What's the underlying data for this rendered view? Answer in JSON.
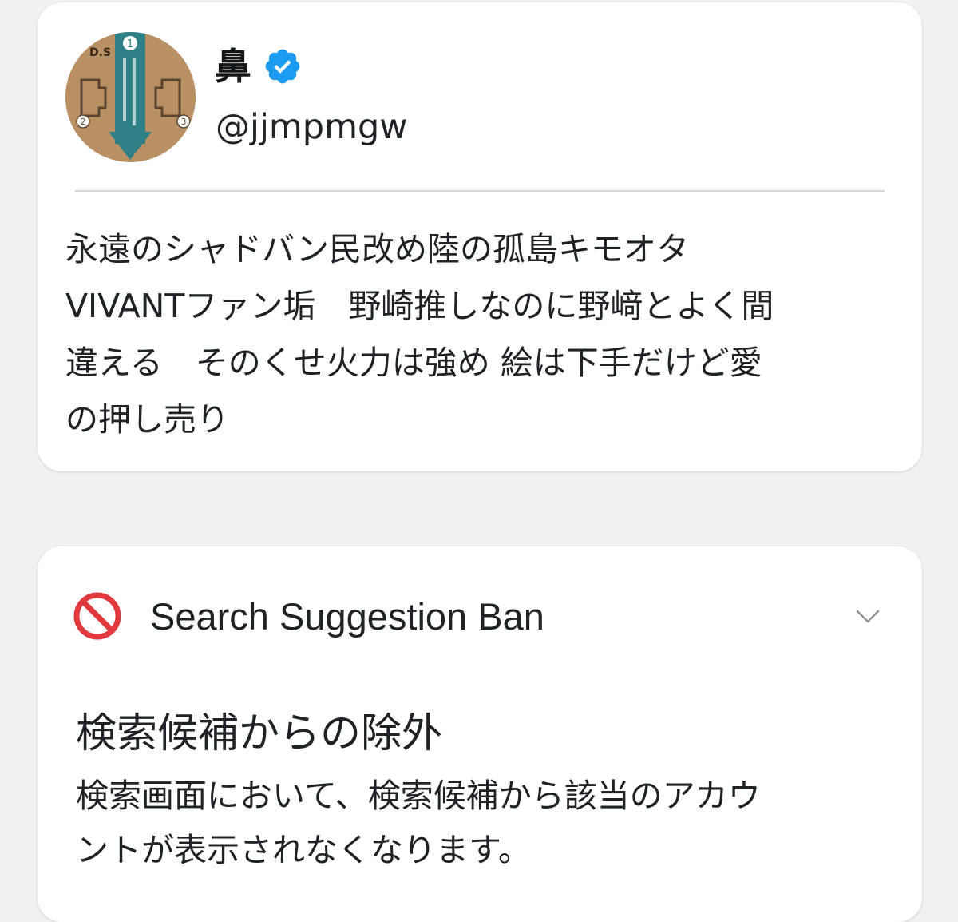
{
  "profile": {
    "display_name": "鼻",
    "handle": "@jjmpmgw",
    "verified": true,
    "bio": "永遠のシャドバン民改め陸の孤島キモオタ\nVIVANTファン垢　野崎推しなのに野﨑とよく間\n違える　そのくせ火力は強め 絵は下手だけど愛\nの押し売り",
    "avatar_icon": "patch-package-photo-icon"
  },
  "ban_check": {
    "title": "Search Suggestion Ban",
    "heading": "検索候補からの除外",
    "description": "検索画面において、検索候補から該当のアカウ\nントが表示されなくなります。",
    "status_icon": "prohibited-icon",
    "expand_icon": "chevron-down-icon"
  },
  "colors": {
    "background": "#f1f1f2",
    "card": "#ffffff",
    "verified_blue": "#1d9bf0",
    "ban_red": "#e0393e",
    "chevron_gray": "#8e9196"
  }
}
